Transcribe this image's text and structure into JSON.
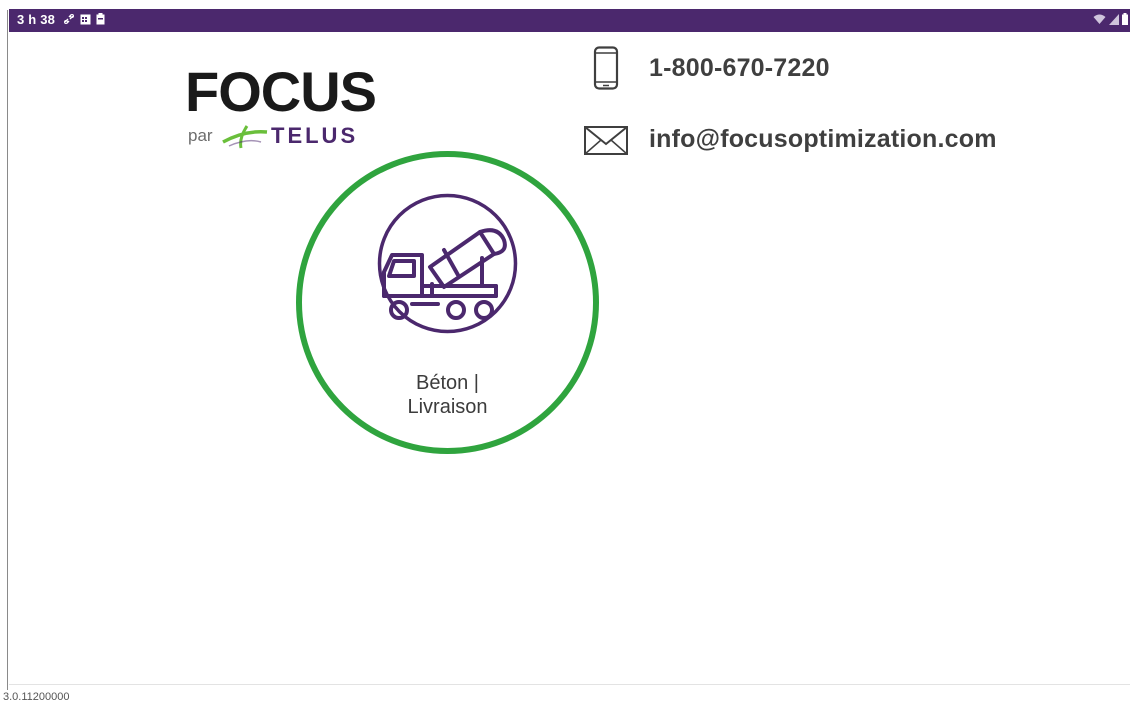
{
  "status_bar": {
    "time": "3 h 38",
    "background_color": "#4b286d",
    "left_icons": [
      "link-icon",
      "calendar-icon",
      "battery-saver-icon"
    ],
    "right_icons": [
      "wifi-icon",
      "signal-icon",
      "battery-icon"
    ]
  },
  "logo": {
    "brand": "FOCUS",
    "tagline_prefix": "par",
    "partner": "TELUS"
  },
  "contact": {
    "phone": "1-800-670-7220",
    "email": "info@focusoptimization.com",
    "phone_icon": "phone-icon",
    "email_icon": "envelope-icon"
  },
  "modules": [
    {
      "label_line1": "Béton |",
      "label_line2": "Livraison",
      "icon": "concrete-mixer-truck-icon",
      "highlight_color": "#2fa43e",
      "icon_color": "#4b286d"
    }
  ],
  "footer": {
    "version": "3.0.11200000"
  }
}
